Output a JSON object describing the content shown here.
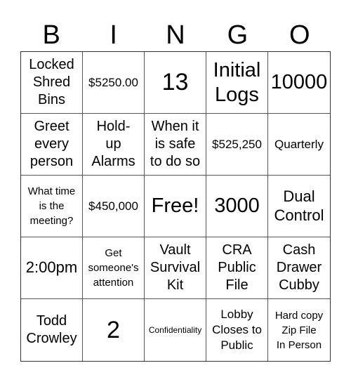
{
  "header": {
    "letters": [
      "B",
      "I",
      "N",
      "G",
      "O"
    ]
  },
  "board": {
    "rows": [
      [
        "Locked\nShred\nBins",
        "$5250.00",
        "13",
        "Initial\nLogs",
        "10000"
      ],
      [
        "Greet\nevery\nperson",
        "Hold-\nup\nAlarms",
        "When it\nis safe\nto do so",
        "$525,250",
        "Quarterly"
      ],
      [
        "What time\nis the\nmeeting?",
        "$450,000",
        "Free!",
        "3000",
        "Dual\nControl"
      ],
      [
        "2:00pm",
        "Get\nsomeone's\nattention",
        "Vault\nSurvival\nKit",
        "CRA\nPublic\nFile",
        "Cash\nDrawer\nCubby"
      ],
      [
        "Todd\nCrowley",
        "2",
        "Confidentiality",
        "Lobby\nCloses to\nPublic",
        "Hard copy\nZip File\nIn Person"
      ]
    ]
  }
}
